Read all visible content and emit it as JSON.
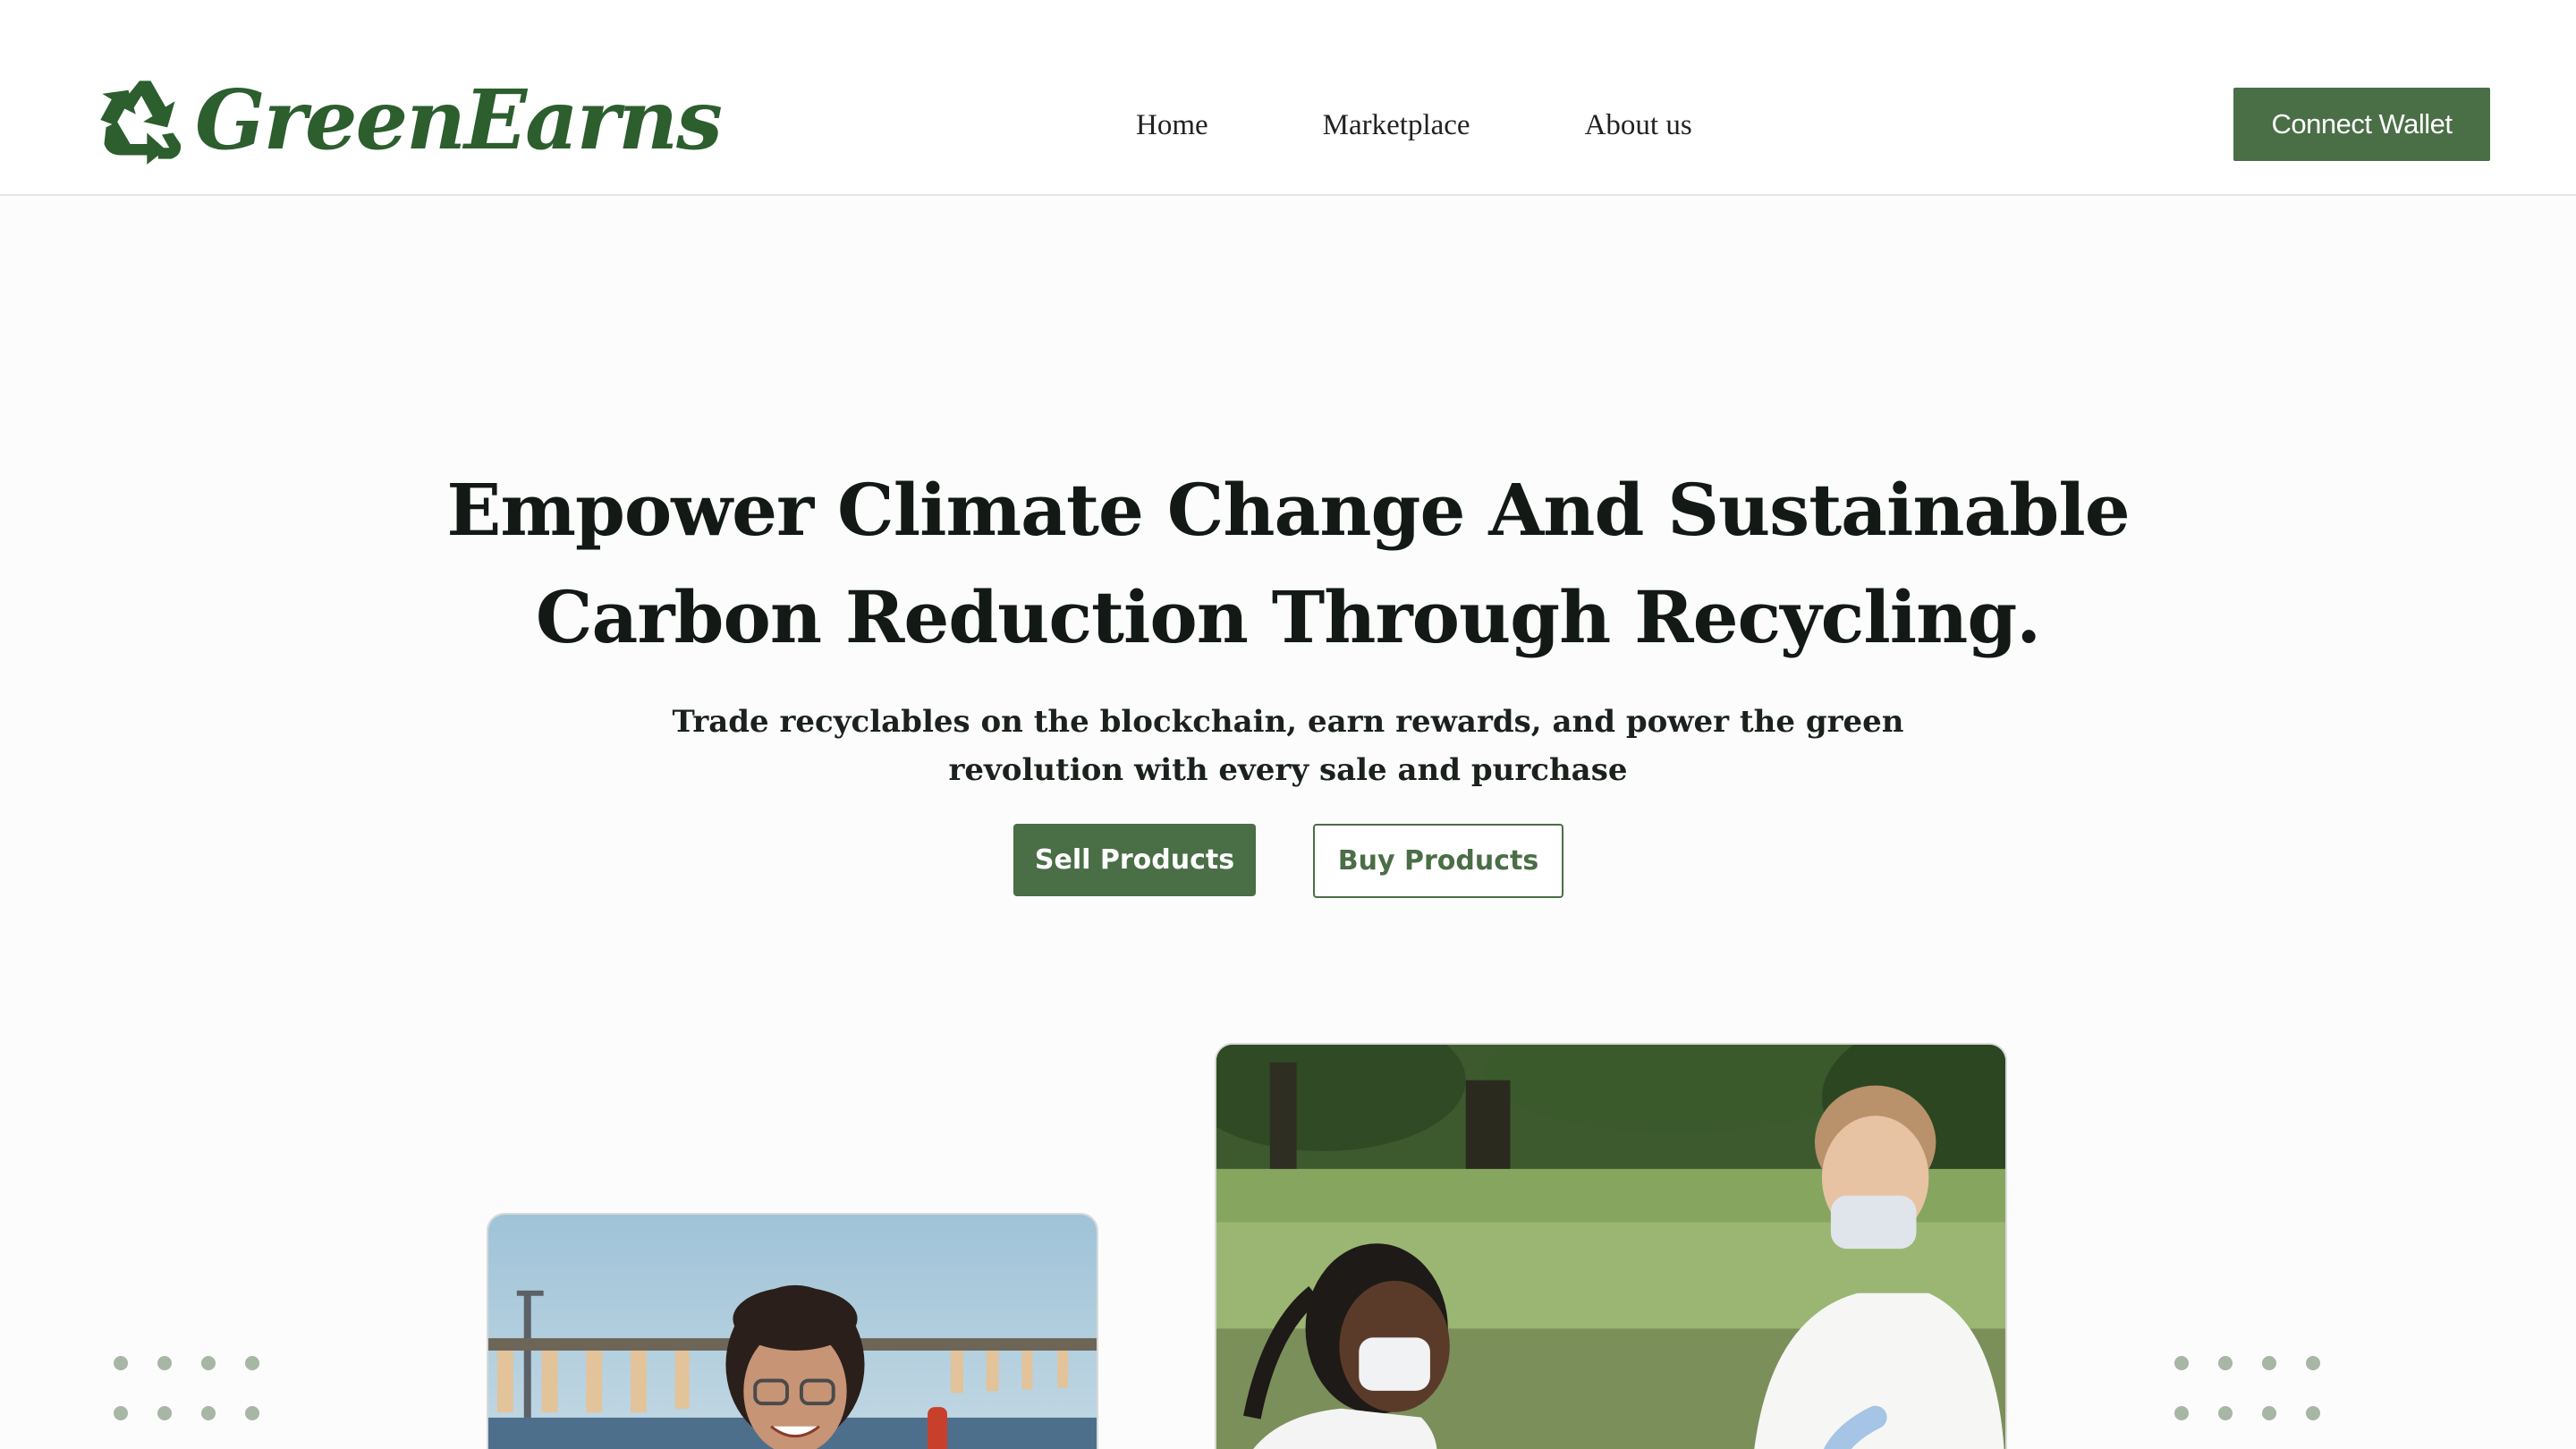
{
  "brand": {
    "name": "GreenEarns",
    "logo_icon": "recycle-icon",
    "color": "#2c5e2e"
  },
  "nav": {
    "items": [
      {
        "label": "Home"
      },
      {
        "label": "Marketplace"
      },
      {
        "label": "About us"
      }
    ]
  },
  "header": {
    "connect_wallet_label": "Connect Wallet"
  },
  "hero": {
    "title_line1": "Empower Climate Change And Sustainable",
    "title_line2": "Carbon Reduction Through Recycling.",
    "subtitle_line1": "Trade recyclables on the blockchain, earn rewards, and power the green",
    "subtitle_line2": "revolution with every sale and purchase",
    "sell_label": "Sell Products",
    "buy_label": "Buy Products"
  },
  "colors": {
    "accent": "#4a6e46",
    "heading": "#131a16",
    "dots": "#a7b6a5"
  }
}
